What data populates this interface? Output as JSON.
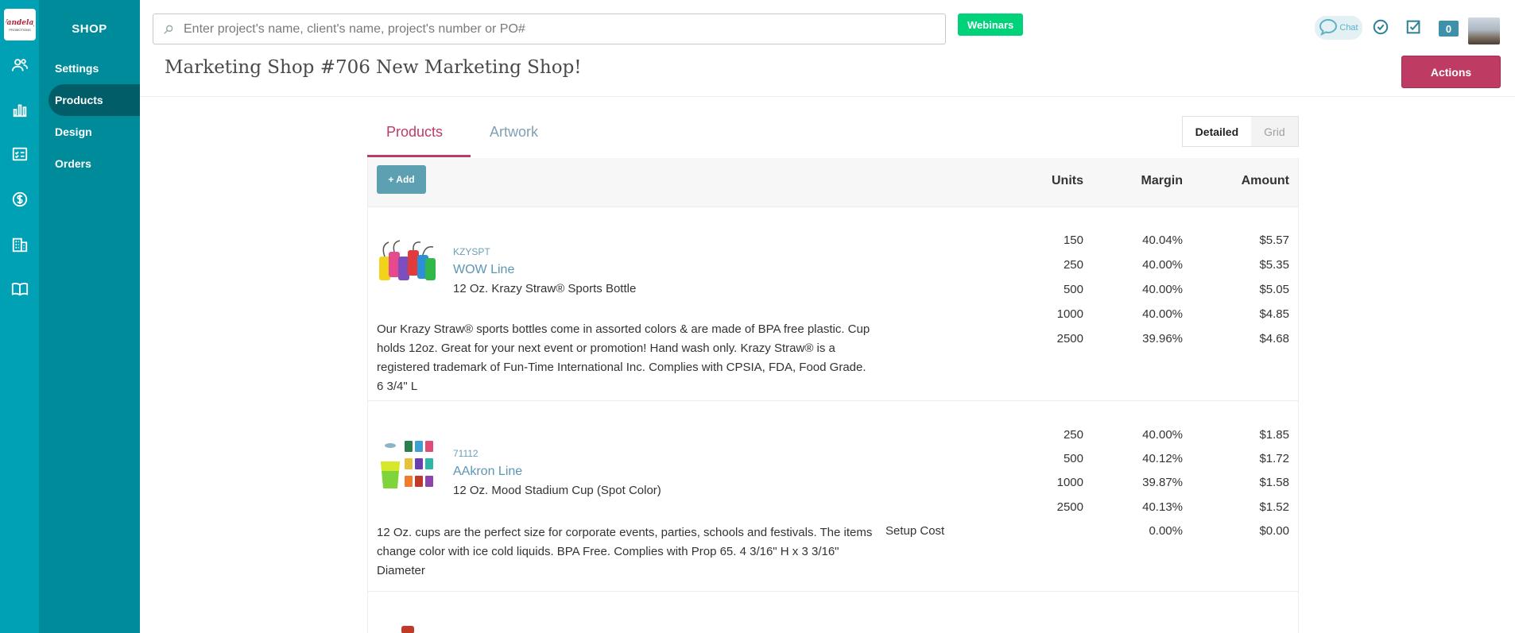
{
  "app": {
    "logo_text": "Vandelay"
  },
  "rail": {
    "icons": [
      "users-icon",
      "bar-chart-icon",
      "checklist-icon",
      "dollar-icon",
      "building-icon",
      "book-icon"
    ]
  },
  "subnav": {
    "title": "SHOP",
    "items": [
      {
        "label": "Settings"
      },
      {
        "label": "Products"
      },
      {
        "label": "Design"
      },
      {
        "label": "Orders"
      }
    ]
  },
  "header": {
    "search_placeholder": "Enter project's name, client's name, project's number or PO#",
    "webinars_label": "Webinars",
    "chat_label": "Chat",
    "badge_count": "0",
    "page_title": "Marketing Shop #706 New Marketing Shop!",
    "actions_label": "Actions"
  },
  "tabs": [
    {
      "label": "Products"
    },
    {
      "label": "Artwork"
    }
  ],
  "view_toggle": {
    "detailed": "Detailed",
    "grid": "Grid"
  },
  "table": {
    "add_label": "+ Add",
    "headers": {
      "units": "Units",
      "margin": "Margin",
      "amount": "Amount"
    },
    "products": [
      {
        "sku": "KZYSPT",
        "line": "WOW Line",
        "name": "12 Oz. Krazy Straw® Sports Bottle",
        "description": "Our Krazy Straw® sports bottles come in assorted colors & are made of BPA free plastic. Cup holds 12oz. Great for your next event or promotion! Hand wash only. Krazy Straw® is a registered trademark of Fun-Time International Inc. Complies with CPSIA, FDA, Food Grade. 6 3/4\" L",
        "pricing": [
          {
            "units": "150",
            "margin": "40.04%",
            "amount": "$5.57"
          },
          {
            "units": "250",
            "margin": "40.00%",
            "amount": "$5.35"
          },
          {
            "units": "500",
            "margin": "40.00%",
            "amount": "$5.05"
          },
          {
            "units": "1000",
            "margin": "40.00%",
            "amount": "$4.85"
          },
          {
            "units": "2500",
            "margin": "39.96%",
            "amount": "$4.68"
          }
        ]
      },
      {
        "sku": "71112",
        "line": "AAkron Line",
        "name": "12 Oz. Mood Stadium Cup (Spot Color)",
        "description": "12 Oz. cups are the perfect size for corporate events, parties, schools and festivals. The items change color with ice cold liquids. BPA Free. Complies with Prop 65. 4 3/16\" H x 3 3/16\" Diameter",
        "pricing": [
          {
            "units": "250",
            "margin": "40.00%",
            "amount": "$1.85"
          },
          {
            "units": "500",
            "margin": "40.12%",
            "amount": "$1.72"
          },
          {
            "units": "1000",
            "margin": "39.87%",
            "amount": "$1.58"
          },
          {
            "units": "2500",
            "margin": "40.13%",
            "amount": "$1.52"
          }
        ],
        "setup": {
          "label": "Setup Cost",
          "margin": "0.00%",
          "amount": "$0.00"
        }
      }
    ]
  },
  "colors": {
    "rail": "#00a1b4",
    "subnav": "#008b9a",
    "accent": "#be3b63",
    "link": "#5c96b5"
  }
}
